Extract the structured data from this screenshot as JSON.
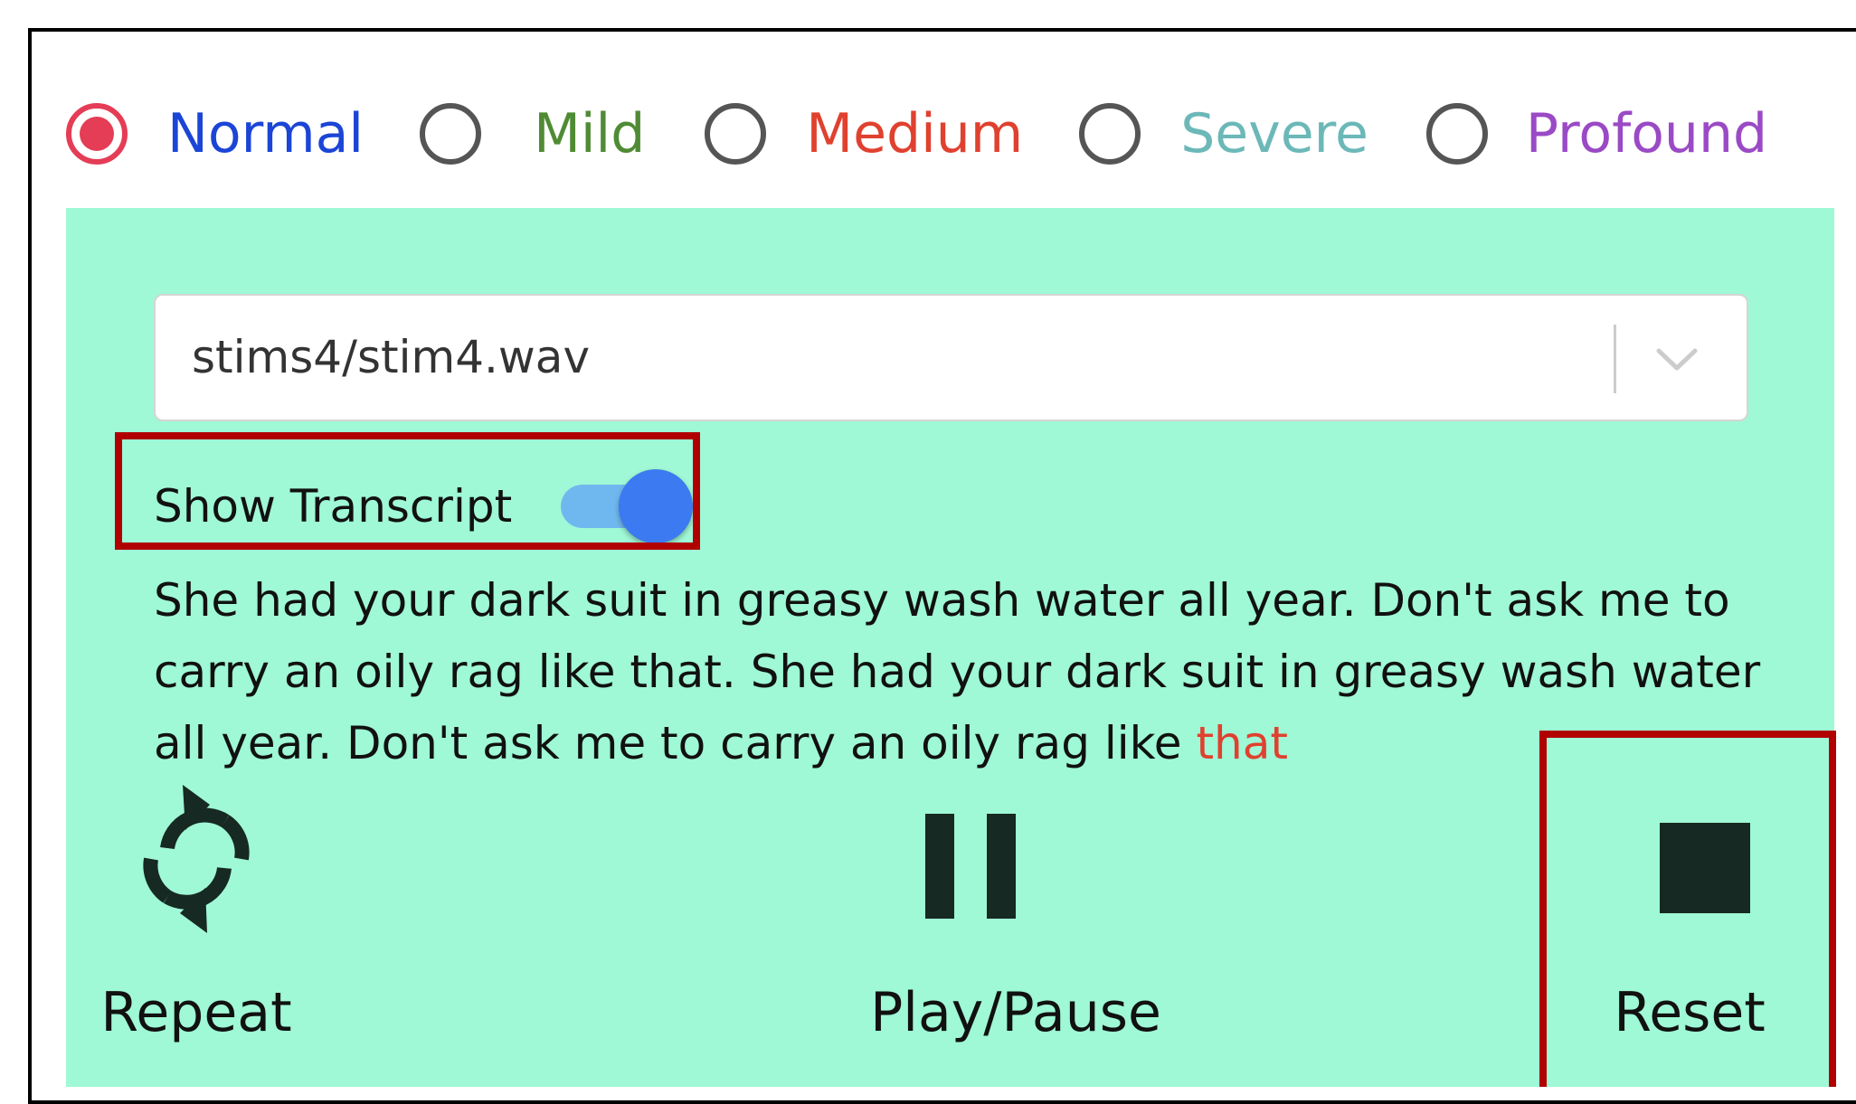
{
  "severity_options": [
    {
      "label": "Normal",
      "color": "#1b45d6",
      "checked": true
    },
    {
      "label": "Mild",
      "color": "#4f8b34",
      "checked": false
    },
    {
      "label": "Medium",
      "color": "#e0412f",
      "checked": false
    },
    {
      "label": "Severe",
      "color": "#6cb8b8",
      "checked": false
    },
    {
      "label": "Profound",
      "color": "#9a4ac5",
      "checked": false
    }
  ],
  "panel_color": "#9ff8d6",
  "file_select": {
    "value": "stims4/stim4.wav",
    "icon": "chevron-down-icon"
  },
  "transcript_toggle": {
    "label": "Show Transcript",
    "on": true
  },
  "transcript": {
    "text": "She had your dark suit in greasy wash water all year. Don't ask me to carry an oily rag like that. She had your dark suit in greasy wash water all year. Don't ask me to carry an oily rag like ",
    "current_word": "that"
  },
  "controls": {
    "repeat": {
      "label": "Repeat",
      "icon": "repeat-icon"
    },
    "play_pause": {
      "label": "Play/Pause",
      "icon": "pause-icon"
    },
    "reset": {
      "label": "Reset",
      "icon": "stop-icon"
    }
  },
  "highlight_color": "#b00000"
}
